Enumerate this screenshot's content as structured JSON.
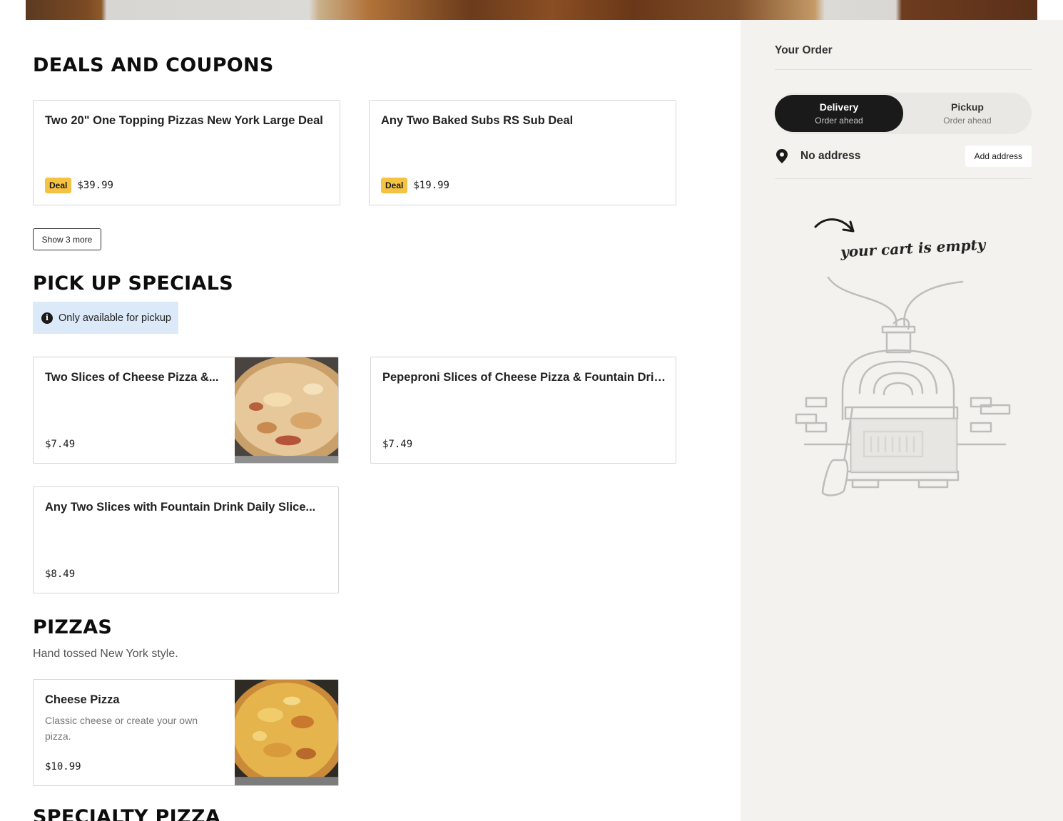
{
  "sections": {
    "deals": {
      "title": "DEALS AND COUPONS",
      "cards": [
        {
          "title": "Two 20\" One Topping Pizzas New York Large Deal",
          "badge": "Deal",
          "price": "$39.99"
        },
        {
          "title": "Any Two Baked Subs RS Sub Deal",
          "badge": "Deal",
          "price": "$19.99"
        }
      ],
      "show_more": "Show 3 more"
    },
    "pickup": {
      "title": "PICK UP SPECIALS",
      "info": "Only available for pickup",
      "cards": [
        {
          "title": "Two Slices of Cheese Pizza &...",
          "price": "$7.49"
        },
        {
          "title": "Pepeproni Slices of Cheese Pizza & Fountain Drink...",
          "price": "$7.49"
        },
        {
          "title": "Any Two Slices with Fountain Drink Daily Slice...",
          "price": "$8.49"
        }
      ]
    },
    "pizzas": {
      "title": "PIZZAS",
      "subtitle": "Hand tossed New York style.",
      "cards": [
        {
          "title": "Cheese Pizza",
          "description": "Classic cheese or create your own pizza.",
          "price": "$10.99"
        }
      ]
    },
    "specialty": {
      "title": "SPECIALTY PIZZA"
    }
  },
  "order": {
    "title": "Your Order",
    "delivery_label": "Delivery",
    "delivery_sub": "Order ahead",
    "pickup_label": "Pickup",
    "pickup_sub": "Order ahead",
    "address": "No address",
    "add_address": "Add address",
    "empty_text": "your cart is empty"
  },
  "colors": {
    "deal_badge": "#f5c242",
    "info_bg": "#dce9f8",
    "sidebar_bg": "#f3f2ef",
    "active_toggle": "#1a1a1a"
  }
}
